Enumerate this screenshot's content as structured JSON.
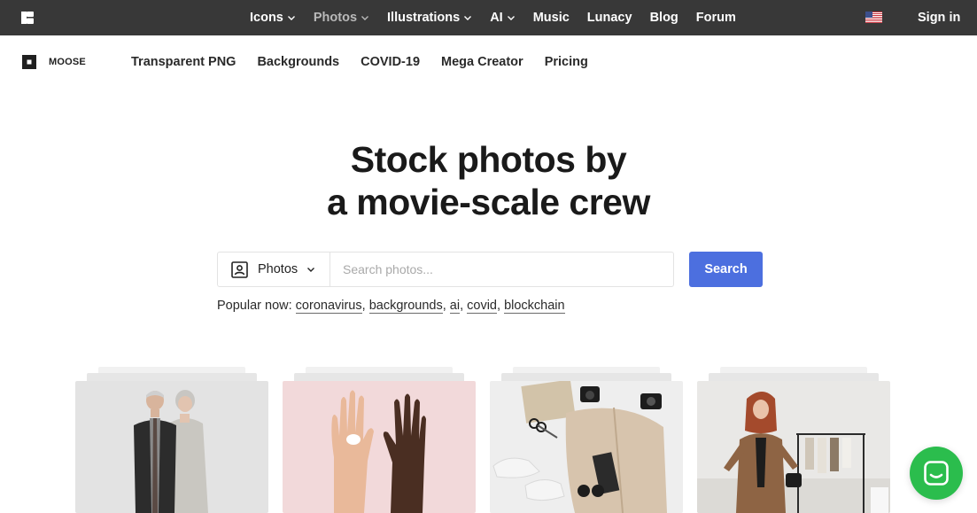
{
  "topbar": {
    "logo_icon": "icons8-logo-icon",
    "nav": [
      {
        "label": "Icons",
        "has_dropdown": true,
        "active": false
      },
      {
        "label": "Photos",
        "has_dropdown": true,
        "active": true
      },
      {
        "label": "Illustrations",
        "has_dropdown": true,
        "active": false
      },
      {
        "label": "AI",
        "has_dropdown": true,
        "active": false
      },
      {
        "label": "Music",
        "has_dropdown": false,
        "active": false
      },
      {
        "label": "Lunacy",
        "has_dropdown": false,
        "active": false
      },
      {
        "label": "Blog",
        "has_dropdown": false,
        "active": false
      },
      {
        "label": "Forum",
        "has_dropdown": false,
        "active": false
      }
    ],
    "language_icon": "us-flag-icon",
    "sign_in": "Sign in"
  },
  "subbar": {
    "brand": "MOOSE",
    "nav": [
      "Transparent PNG",
      "Backgrounds",
      "COVID-19",
      "Mega Creator",
      "Pricing"
    ]
  },
  "hero": {
    "title_line1": "Stock photos by",
    "title_line2": "a movie-scale crew"
  },
  "search": {
    "type_selected": "Photos",
    "placeholder": "Search photos...",
    "value": "",
    "button": "Search"
  },
  "popular": {
    "label": "Popular now:",
    "tags": [
      "coronavirus",
      "backgrounds",
      "ai",
      "covid",
      "blockchain"
    ]
  },
  "cards": [
    {
      "subject": "senior-couple-photo"
    },
    {
      "subject": "hands-with-pill-photo"
    },
    {
      "subject": "flat-lay-fashion-photo"
    },
    {
      "subject": "woman-in-wardrobe-photo"
    }
  ],
  "colors": {
    "topbar_bg": "#383838",
    "accent": "#4c6fdf",
    "chat_green": "#2bbd4d"
  },
  "chat_icon": "chat-bubble-icon"
}
